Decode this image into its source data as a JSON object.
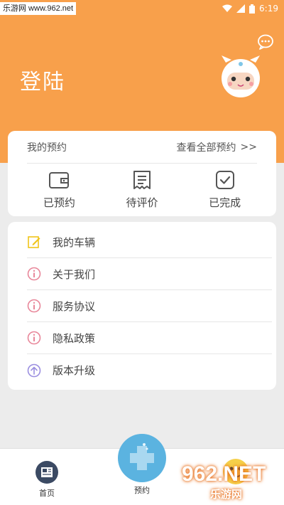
{
  "status_bar": {
    "watermark": "乐游网 www.962.net",
    "time": "6:19",
    "icons": [
      "wifi-icon",
      "signal-icon",
      "battery-icon"
    ]
  },
  "header": {
    "title": "登陆",
    "chat_icon": "chat-bubble-icon",
    "avatar_icon": "cartoon-avatar-icon",
    "bg_color": "#f8a04b"
  },
  "reservation": {
    "title": "我的预约",
    "view_all": "查看全部预约",
    "view_all_arrow": ">>",
    "items": [
      {
        "label": "已预约",
        "icon": "wallet-icon"
      },
      {
        "label": "待评价",
        "icon": "receipt-icon"
      },
      {
        "label": "已完成",
        "icon": "check-box-icon"
      }
    ]
  },
  "menu": {
    "items": [
      {
        "label": "我的车辆",
        "icon": "edit-icon",
        "color": "#f0c419"
      },
      {
        "label": "关于我们",
        "icon": "info-icon",
        "color": "#e8879a"
      },
      {
        "label": "服务协议",
        "icon": "info-icon",
        "color": "#e8879a"
      },
      {
        "label": "隐私政策",
        "icon": "info-icon",
        "color": "#e8879a"
      },
      {
        "label": "版本升级",
        "icon": "upgrade-arrow-icon",
        "color": "#9b8fe0"
      }
    ]
  },
  "bottom_nav": {
    "home": "首页",
    "reserve": "预约",
    "me_icon": "smiley-face-icon"
  },
  "corner_watermark": {
    "big": "962.NET",
    "small": "乐游网"
  }
}
